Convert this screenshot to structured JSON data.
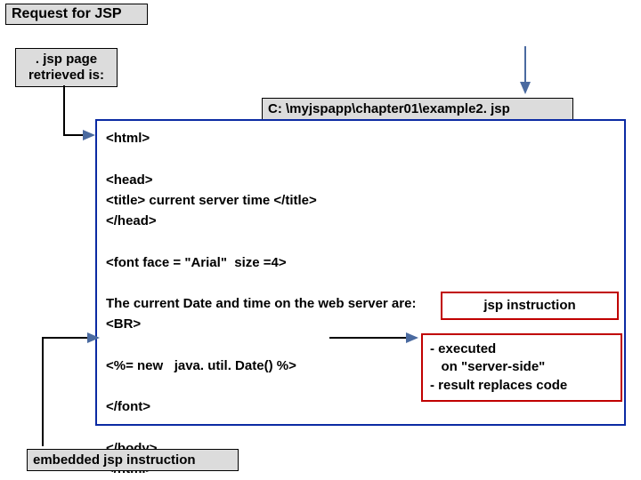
{
  "title": "Request  for  JSP",
  "retrieved": ". jsp   page\nretrieved is:",
  "path": "C: \\myjspapp\\chapter01\\example2. jsp",
  "code": "<html>\n\n<head>\n<title> current server time </title>\n</head>\n\n<font face = \"Arial\"  size =4>\n\nThe current Date and time on the web server are:\n<BR>\n\n<%= new   java. util. Date() %>\n\n</font>\n\n</body>\n</html>",
  "annotTitle": "jsp instruction",
  "annotDesc": "- executed\n   on \"server-side\"\n- result replaces code",
  "embedded": "embedded   jsp instruction"
}
